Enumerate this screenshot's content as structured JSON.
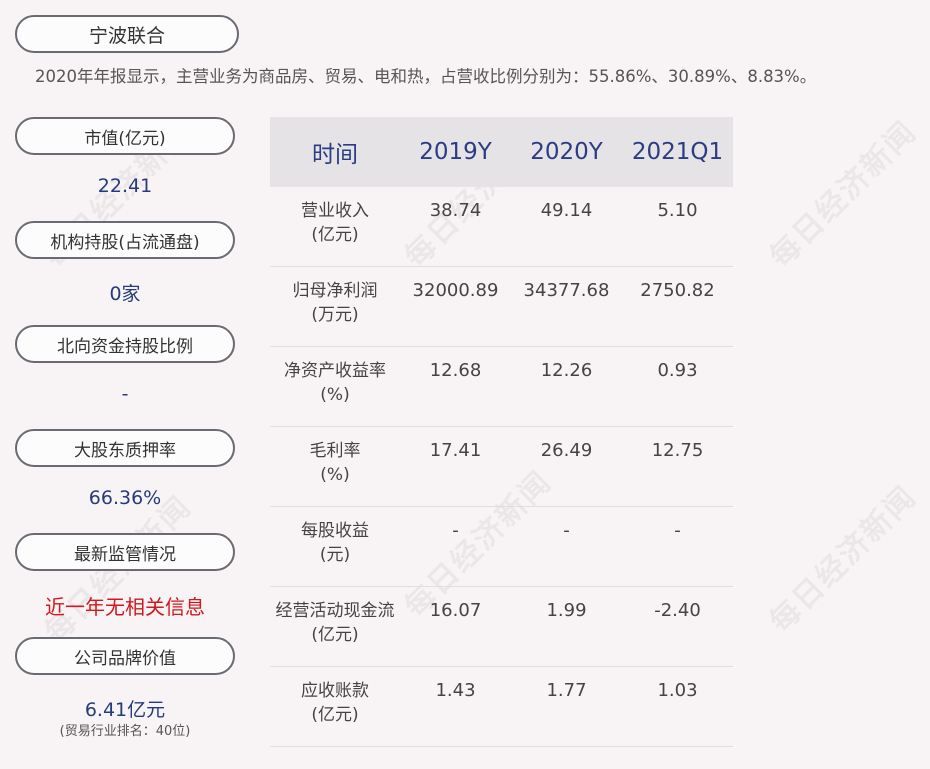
{
  "company": {
    "name": "宁波联合"
  },
  "summary": "2020年年报显示，主营业务为商品房、贸易、电和热，占营收比例分别为：55.86%、30.89%、8.83%。",
  "watermark": "每日经济新闻",
  "side": [
    {
      "label": "市值(亿元)",
      "value": "22.41"
    },
    {
      "label": "机构持股(占流通盘)",
      "value": "0家"
    },
    {
      "label": "北向资金持股比例",
      "value": "-"
    },
    {
      "label": "大股东质押率",
      "value": "66.36%"
    },
    {
      "label": "最新监管情况",
      "value": "近一年无相关信息",
      "color": "#d0181e"
    },
    {
      "label": "公司品牌价值",
      "value": "6.41亿元",
      "note": "(贸易行业排名：40位)"
    }
  ],
  "table": {
    "headers": [
      "时间",
      "2019Y",
      "2020Y",
      "2021Q1"
    ],
    "rows": [
      {
        "label1": "营业收入",
        "label2": "(亿元)",
        "values": [
          "38.74",
          "49.14",
          "5.10"
        ]
      },
      {
        "label1": "归母净利润",
        "label2": "(万元)",
        "values": [
          "32000.89",
          "34377.68",
          "2750.82"
        ]
      },
      {
        "label1": "净资产收益率",
        "label2": "(%)",
        "values": [
          "12.68",
          "12.26",
          "0.93"
        ]
      },
      {
        "label1": "毛利率",
        "label2": "(%)",
        "values": [
          "17.41",
          "26.49",
          "12.75"
        ]
      },
      {
        "label1": "每股收益",
        "label2": "(元)",
        "values": [
          "-",
          "-",
          "-"
        ]
      },
      {
        "label1": "经营活动现金流",
        "label2": "(亿元)",
        "values": [
          "16.07",
          "1.99",
          "-2.40"
        ]
      },
      {
        "label1": "应收账款",
        "label2": "(亿元)",
        "values": [
          "1.43",
          "1.77",
          "1.03"
        ]
      }
    ]
  }
}
